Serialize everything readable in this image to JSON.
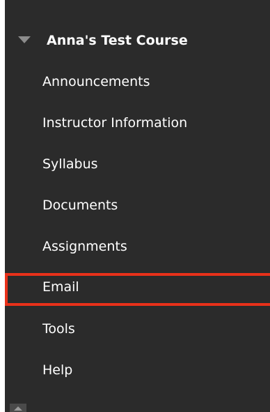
{
  "course": {
    "title": "Anna's Test Course"
  },
  "menu": {
    "items": [
      {
        "label": "Announcements"
      },
      {
        "label": "Instructor Information"
      },
      {
        "label": "Syllabus"
      },
      {
        "label": "Documents"
      },
      {
        "label": "Assignments"
      },
      {
        "label": "Email",
        "selected": true
      },
      {
        "label": "Tools"
      },
      {
        "label": "Help"
      }
    ]
  },
  "colors": {
    "sidebar_bg": "#2b2b2b",
    "text": "#ffffff",
    "highlight_border": "#e8311a",
    "toggle_icon": "#8c8c8c"
  }
}
